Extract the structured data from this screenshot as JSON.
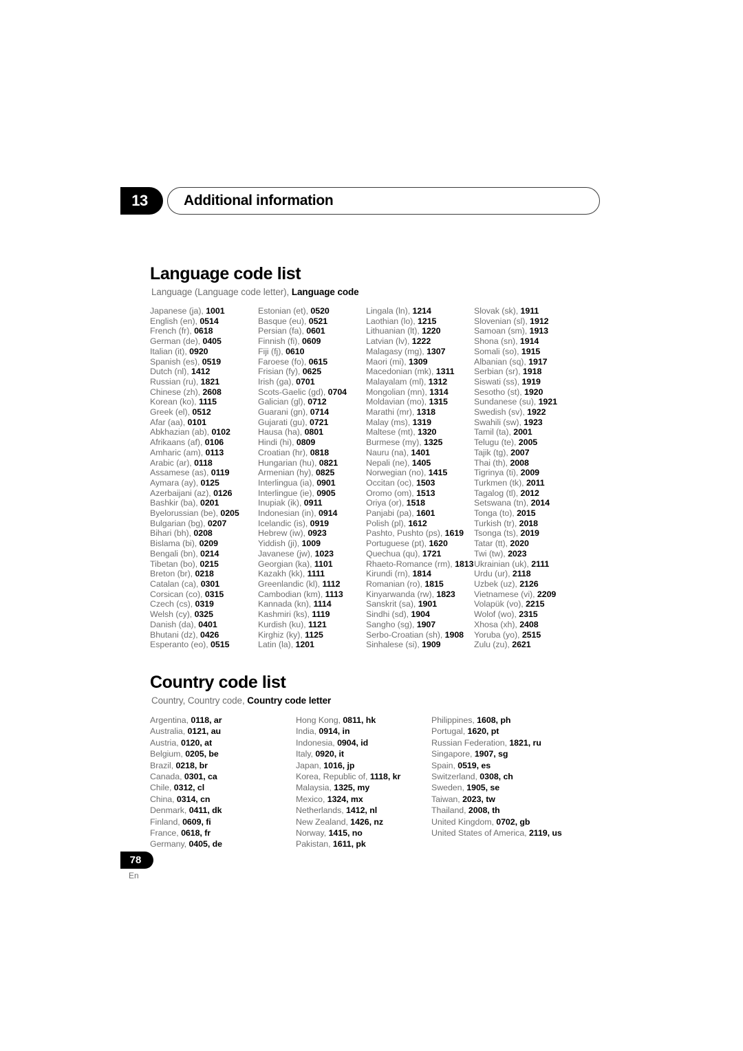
{
  "chapter": {
    "number": "13",
    "title": "Additional information"
  },
  "language_section": {
    "title": "Language code list",
    "subtitle_plain": "Language (Language code letter), ",
    "subtitle_bold": "Language code",
    "columns": [
      [
        {
          "name": "Japanese (ja), ",
          "code": "1001"
        },
        {
          "name": "English (en), ",
          "code": "0514"
        },
        {
          "name": "French (fr), ",
          "code": "0618"
        },
        {
          "name": "German (de), ",
          "code": "0405"
        },
        {
          "name": "Italian (it), ",
          "code": "0920"
        },
        {
          "name": "Spanish (es), ",
          "code": "0519"
        },
        {
          "name": "Dutch (nl), ",
          "code": "1412"
        },
        {
          "name": "Russian (ru), ",
          "code": "1821"
        },
        {
          "name": "Chinese (zh), ",
          "code": "2608"
        },
        {
          "name": "Korean (ko), ",
          "code": "1115"
        },
        {
          "name": "Greek (el), ",
          "code": "0512"
        },
        {
          "name": "Afar (aa), ",
          "code": "0101"
        },
        {
          "name": "Abkhazian (ab), ",
          "code": "0102"
        },
        {
          "name": "Afrikaans (af), ",
          "code": "0106"
        },
        {
          "name": "Amharic (am), ",
          "code": "0113"
        },
        {
          "name": "Arabic (ar), ",
          "code": "0118"
        },
        {
          "name": "Assamese (as), ",
          "code": "0119"
        },
        {
          "name": "Aymara (ay), ",
          "code": "0125"
        },
        {
          "name": "Azerbaijani (az), ",
          "code": "0126"
        },
        {
          "name": "Bashkir (ba), ",
          "code": "0201"
        },
        {
          "name": "Byelorussian (be), ",
          "code": "0205"
        },
        {
          "name": "Bulgarian (bg), ",
          "code": "0207"
        },
        {
          "name": "Bihari (bh), ",
          "code": "0208"
        },
        {
          "name": "Bislama (bi), ",
          "code": "0209"
        },
        {
          "name": "Bengali (bn), ",
          "code": "0214"
        },
        {
          "name": "Tibetan (bo), ",
          "code": "0215"
        },
        {
          "name": "Breton (br), ",
          "code": "0218"
        },
        {
          "name": "Catalan (ca), ",
          "code": "0301"
        },
        {
          "name": "Corsican (co), ",
          "code": "0315"
        },
        {
          "name": "Czech (cs), ",
          "code": "0319"
        },
        {
          "name": "Welsh (cy), ",
          "code": "0325"
        },
        {
          "name": "Danish (da), ",
          "code": "0401"
        },
        {
          "name": "Bhutani (dz), ",
          "code": "0426"
        },
        {
          "name": "Esperanto (eo), ",
          "code": "0515"
        }
      ],
      [
        {
          "name": "Estonian (et), ",
          "code": "0520"
        },
        {
          "name": "Basque (eu), ",
          "code": "0521"
        },
        {
          "name": "Persian (fa), ",
          "code": "0601"
        },
        {
          "name": "Finnish (fi), ",
          "code": "0609"
        },
        {
          "name": "Fiji (fj), ",
          "code": "0610"
        },
        {
          "name": "Faroese (fo), ",
          "code": "0615"
        },
        {
          "name": "Frisian (fy), ",
          "code": "0625"
        },
        {
          "name": "Irish (ga), ",
          "code": "0701"
        },
        {
          "name": "Scots-Gaelic (gd), ",
          "code": "0704"
        },
        {
          "name": "Galician (gl), ",
          "code": "0712"
        },
        {
          "name": "Guarani (gn), ",
          "code": "0714"
        },
        {
          "name": "Gujarati (gu), ",
          "code": "0721"
        },
        {
          "name": "Hausa (ha), ",
          "code": "0801"
        },
        {
          "name": "Hindi (hi), ",
          "code": "0809"
        },
        {
          "name": "Croatian (hr), ",
          "code": "0818"
        },
        {
          "name": "Hungarian (hu), ",
          "code": "0821"
        },
        {
          "name": "Armenian (hy), ",
          "code": "0825"
        },
        {
          "name": "Interlingua (ia), ",
          "code": "0901"
        },
        {
          "name": "Interlingue (ie), ",
          "code": "0905"
        },
        {
          "name": "Inupiak (ik), ",
          "code": "0911"
        },
        {
          "name": "Indonesian (in), ",
          "code": "0914"
        },
        {
          "name": "Icelandic (is), ",
          "code": "0919"
        },
        {
          "name": "Hebrew (iw), ",
          "code": "0923"
        },
        {
          "name": "Yiddish (ji), ",
          "code": "1009"
        },
        {
          "name": "Javanese (jw), ",
          "code": "1023"
        },
        {
          "name": "Georgian (ka), ",
          "code": "1101"
        },
        {
          "name": "Kazakh (kk), ",
          "code": "1111"
        },
        {
          "name": "Greenlandic  (kl), ",
          "code": "1112"
        },
        {
          "name": "Cambodian (km), ",
          "code": "1113"
        },
        {
          "name": "Kannada (kn), ",
          "code": "1114"
        },
        {
          "name": "Kashmiri (ks), ",
          "code": "1119"
        },
        {
          "name": "Kurdish (ku), ",
          "code": "1121"
        },
        {
          "name": "Kirghiz (ky), ",
          "code": "1125"
        },
        {
          "name": "Latin (la), ",
          "code": "1201"
        }
      ],
      [
        {
          "name": "Lingala (ln), ",
          "code": "1214"
        },
        {
          "name": "Laothian (lo), ",
          "code": "1215"
        },
        {
          "name": "Lithuanian (lt), ",
          "code": "1220"
        },
        {
          "name": "Latvian (lv), ",
          "code": "1222"
        },
        {
          "name": "Malagasy (mg), ",
          "code": "1307"
        },
        {
          "name": "Maori (mi), ",
          "code": "1309"
        },
        {
          "name": "Macedonian (mk), ",
          "code": "1311"
        },
        {
          "name": "Malayalam  (ml), ",
          "code": "1312"
        },
        {
          "name": "Mongolian (mn), ",
          "code": "1314"
        },
        {
          "name": "Moldavian (mo), ",
          "code": "1315"
        },
        {
          "name": "Marathi (mr), ",
          "code": "1318"
        },
        {
          "name": "Malay  (ms), ",
          "code": "1319"
        },
        {
          "name": "Maltese (mt), ",
          "code": "1320"
        },
        {
          "name": "Burmese (my), ",
          "code": "1325"
        },
        {
          "name": "Nauru (na), ",
          "code": "1401"
        },
        {
          "name": "Nepali (ne), ",
          "code": "1405"
        },
        {
          "name": "Norwegian (no), ",
          "code": "1415"
        },
        {
          "name": "Occitan (oc), ",
          "code": "1503"
        },
        {
          "name": "Oromo (om), ",
          "code": "1513"
        },
        {
          "name": "Oriya (or), ",
          "code": "1518"
        },
        {
          "name": "Panjabi (pa), ",
          "code": "1601"
        },
        {
          "name": "Polish (pl), ",
          "code": "1612"
        },
        {
          "name": "Pashto, Pushto (ps), ",
          "code": "1619"
        },
        {
          "name": "Portuguese (pt), ",
          "code": "1620"
        },
        {
          "name": "Quechua (qu), ",
          "code": "1721"
        },
        {
          "name": "Rhaeto-Romance (rm), ",
          "code": "1813"
        },
        {
          "name": "Kirundi (rn), ",
          "code": "1814"
        },
        {
          "name": "Romanian (ro), ",
          "code": "1815"
        },
        {
          "name": "Kinyarwanda (rw), ",
          "code": "1823"
        },
        {
          "name": "Sanskrit (sa), ",
          "code": "1901"
        },
        {
          "name": "Sindhi (sd), ",
          "code": "1904"
        },
        {
          "name": "Sangho (sg), ",
          "code": "1907"
        },
        {
          "name": "Serbo-Croatian (sh), ",
          "code": "1908"
        },
        {
          "name": "Sinhalese (si), ",
          "code": "1909"
        }
      ],
      [
        {
          "name": "Slovak (sk), ",
          "code": "1911"
        },
        {
          "name": "Slovenian (sl), ",
          "code": "1912"
        },
        {
          "name": "Samoan (sm), ",
          "code": "1913"
        },
        {
          "name": "Shona (sn), ",
          "code": "1914"
        },
        {
          "name": "Somali (so), ",
          "code": "1915"
        },
        {
          "name": "Albanian (sq), ",
          "code": "1917"
        },
        {
          "name": "Serbian (sr), ",
          "code": "1918"
        },
        {
          "name": "Siswati (ss), ",
          "code": "1919"
        },
        {
          "name": "Sesotho (st), ",
          "code": "1920"
        },
        {
          "name": "Sundanese (su), ",
          "code": "1921"
        },
        {
          "name": "Swedish (sv), ",
          "code": "1922"
        },
        {
          "name": "Swahili (sw), ",
          "code": "1923"
        },
        {
          "name": "Tamil (ta), ",
          "code": "2001"
        },
        {
          "name": "Telugu (te), ",
          "code": "2005"
        },
        {
          "name": "Tajik (tg), ",
          "code": "2007"
        },
        {
          "name": "Thai (th), ",
          "code": "2008"
        },
        {
          "name": "Tigrinya (ti), ",
          "code": "2009"
        },
        {
          "name": "Turkmen (tk), ",
          "code": "2011"
        },
        {
          "name": "Tagalog (tl), ",
          "code": "2012"
        },
        {
          "name": "Setswana (tn), ",
          "code": "2014"
        },
        {
          "name": "Tonga (to), ",
          "code": "2015"
        },
        {
          "name": "Turkish (tr), ",
          "code": "2018"
        },
        {
          "name": "Tsonga (ts), ",
          "code": "2019"
        },
        {
          "name": "Tatar (tt), ",
          "code": "2020"
        },
        {
          "name": "Twi (tw), ",
          "code": "2023"
        },
        {
          "name": "Ukrainian (uk), ",
          "code": "2111"
        },
        {
          "name": "Urdu (ur), ",
          "code": "2118"
        },
        {
          "name": "Uzbek (uz), ",
          "code": "2126"
        },
        {
          "name": "Vietnamese (vi), ",
          "code": "2209"
        },
        {
          "name": "Volapük (vo), ",
          "code": "2215"
        },
        {
          "name": "Wolof (wo), ",
          "code": "2315"
        },
        {
          "name": "Xhosa (xh), ",
          "code": "2408"
        },
        {
          "name": "Yoruba (yo), ",
          "code": "2515"
        },
        {
          "name": "Zulu (zu), ",
          "code": "2621"
        }
      ]
    ]
  },
  "country_section": {
    "title": "Country code list",
    "subtitle_plain": "Country, Country code, ",
    "subtitle_bold": "Country code letter",
    "columns": [
      [
        {
          "name": "Argentina, ",
          "code": "0118, ar"
        },
        {
          "name": "Australia, ",
          "code": "0121, au"
        },
        {
          "name": "Austria, ",
          "code": "0120, at"
        },
        {
          "name": "Belgium, ",
          "code": "0205, be"
        },
        {
          "name": "Brazil, ",
          "code": "0218, br"
        },
        {
          "name": "Canada, ",
          "code": "0301, ca"
        },
        {
          "name": "Chile, ",
          "code": "0312, cl"
        },
        {
          "name": "China, ",
          "code": "0314, cn"
        },
        {
          "name": "Denmark, ",
          "code": "0411, dk"
        },
        {
          "name": "Finland, ",
          "code": "0609, fi"
        },
        {
          "name": "France, ",
          "code": "0618, fr"
        },
        {
          "name": "Germany, ",
          "code": "0405, de"
        }
      ],
      [
        {
          "name": "Hong Kong, ",
          "code": "0811, hk"
        },
        {
          "name": "India, ",
          "code": "0914, in"
        },
        {
          "name": "Indonesia, ",
          "code": "0904, id"
        },
        {
          "name": "Italy, ",
          "code": "0920, it"
        },
        {
          "name": "Japan, ",
          "code": "1016, jp"
        },
        {
          "name": "Korea, Republic of, ",
          "code": "1118, kr"
        },
        {
          "name": "Malaysia, ",
          "code": "1325, my"
        },
        {
          "name": "Mexico, ",
          "code": "1324, mx"
        },
        {
          "name": "Netherlands, ",
          "code": "1412, nl"
        },
        {
          "name": "New Zealand, ",
          "code": "1426, nz"
        },
        {
          "name": "Norway, ",
          "code": "1415, no"
        },
        {
          "name": "Pakistan, ",
          "code": "1611, pk"
        }
      ],
      [
        {
          "name": "Philippines, ",
          "code": "1608, ph"
        },
        {
          "name": "Portugal, ",
          "code": "1620, pt"
        },
        {
          "name": "Russian Federation, ",
          "code": "1821, ru"
        },
        {
          "name": "Singapore, ",
          "code": "1907, sg"
        },
        {
          "name": "Spain, ",
          "code": "0519, es"
        },
        {
          "name": "Switzerland, ",
          "code": "0308, ch"
        },
        {
          "name": "Sweden, ",
          "code": "1905, se"
        },
        {
          "name": "Taiwan, ",
          "code": "2023, tw"
        },
        {
          "name": "Thailand, ",
          "code": "2008, th"
        },
        {
          "name": "United Kingdom, ",
          "code": "0702, gb"
        },
        {
          "name": "United States of America, ",
          "code": "2119, us"
        }
      ]
    ]
  },
  "footer": {
    "page_number": "78",
    "language_label": "En"
  },
  "colors": {
    "text_muted": "#6e6e6e",
    "text_strong": "#000000",
    "badge_bg": "#000000",
    "pill_border": "#3a3a3a"
  }
}
